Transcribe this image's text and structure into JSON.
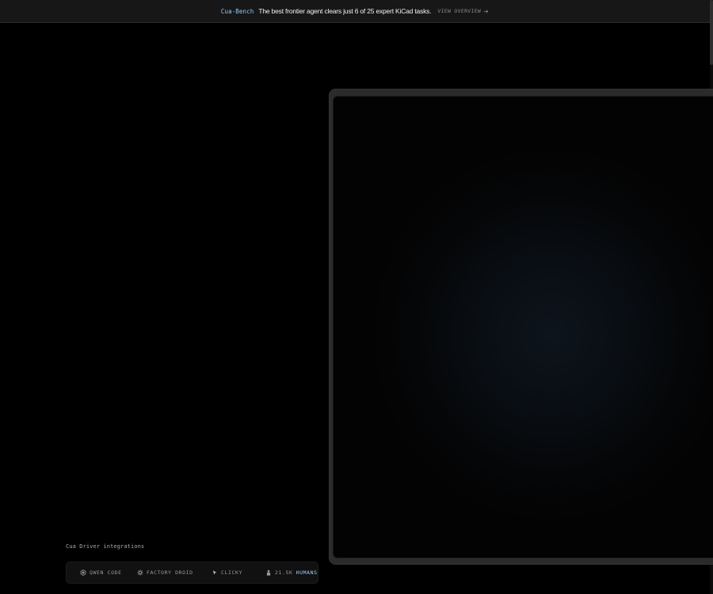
{
  "banner": {
    "brand": "Cua-Bench",
    "message": "The best frontier agent clears just 6 of 25 expert KiCad tasks.",
    "link_label": "VIEW OVERVIEW",
    "link_icon": "arrow-right-icon"
  },
  "integrations": {
    "label": "Cua Driver integrations",
    "items": [
      {
        "label": "QWEN CODE",
        "icon": "qwen-icon"
      },
      {
        "label": "FACTORY DROID",
        "icon": "factory-droid-icon"
      },
      {
        "label": "CLICKY",
        "icon": "cursor-icon"
      }
    ],
    "humans": {
      "count": "21.5K",
      "label": "HUMANS",
      "icon": "person-icon"
    }
  },
  "colors": {
    "accent": "#8ec7ff",
    "background": "#000000",
    "banner_background": "#171717"
  }
}
